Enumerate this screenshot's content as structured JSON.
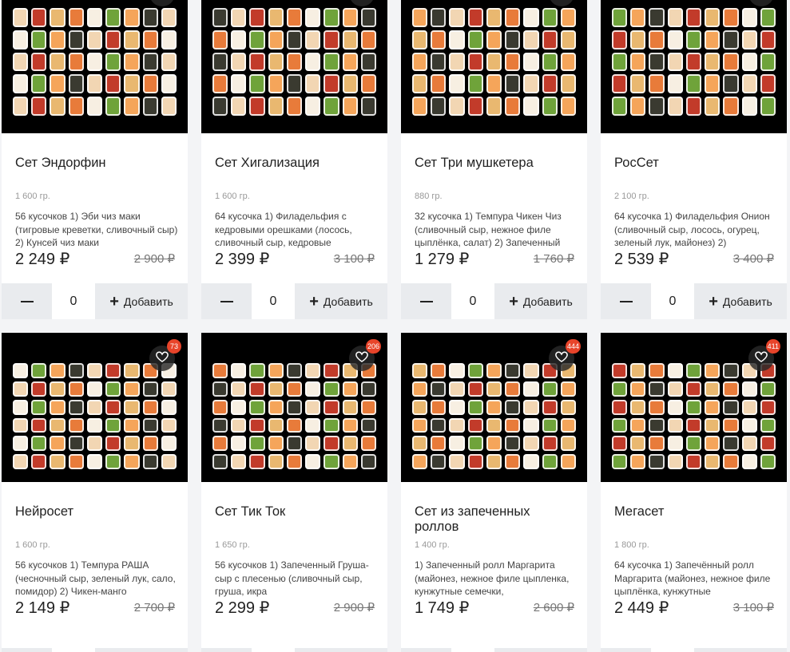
{
  "currency": "₽",
  "products": [
    {
      "title": "Сет Эндорфин",
      "weight": "1 600 гр.",
      "description": "56 кусочков 1) Эби чиз маки (тигровые креветки, сливочный сыр) 2) Кунсей чиз маки",
      "price": "2 249 ₽",
      "old_price": "2 900 ₽",
      "quantity": "0",
      "add_label": "Добавить",
      "badge": ""
    },
    {
      "title": "Сет Хигализация",
      "weight": "1 600 гр.",
      "description": "64 кусочка 1) Филадельфия с кедровыми орешками (лосось, сливочный сыр, кедровые",
      "price": "2 399 ₽",
      "old_price": "3 100 ₽",
      "quantity": "0",
      "add_label": "Добавить",
      "badge": ""
    },
    {
      "title": "Сет Три мушкетера",
      "weight": "880 гр.",
      "description": "32 кусочка 1) Темпура Чикен Чиз (сливочный сыр, нежное филе цыплёнка, салат) 2) Запеченный",
      "price": "1 279 ₽",
      "old_price": "1 760 ₽",
      "quantity": "0",
      "add_label": "Добавить",
      "badge": ""
    },
    {
      "title": "РосСет",
      "weight": "2 100 гр.",
      "description": "64 кусочка 1) Филадельфия Онион (сливочный сыр, лосось, огурец, зеленый лук, майонез) 2)",
      "price": "2 539 ₽",
      "old_price": "3 400 ₽",
      "quantity": "0",
      "add_label": "Добавить",
      "badge": ""
    },
    {
      "title": "Нейросет",
      "weight": "1 600 гр.",
      "description": "56 кусочков 1) Темпура РАША (чесночный сыр, зеленый лук, сало, помидор) 2) Чикен-манго",
      "price": "2 149 ₽",
      "old_price": "2 700 ₽",
      "quantity": "0",
      "add_label": "Добавить",
      "badge": "73"
    },
    {
      "title": "Сет Тик Ток",
      "weight": "1 650 гр.",
      "description": "56 кусочков 1) Запеченный Груша-сыр с плесенью (сливочный сыр, груша, икра",
      "price": "2 299 ₽",
      "old_price": "2 900 ₽",
      "quantity": "0",
      "add_label": "Добавить",
      "badge": "206"
    },
    {
      "title": "Сет из запеченных роллов",
      "weight": "1 400 гр.",
      "description": "1) Запеченный ролл Маргарита (майонез, нежное филе цыпленка, кунжутные семечки,",
      "price": "1 749 ₽",
      "old_price": "2 600 ₽",
      "quantity": "0",
      "add_label": "Добавить",
      "badge": "444"
    },
    {
      "title": "Мегасет",
      "weight": "1 800 гр.",
      "description": "64 кусочка 1) Запечённый ролл Маргарита (майонез, нежное филе цыплёнка, кунжутные",
      "price": "2 449 ₽",
      "old_price": "3 100 ₽",
      "quantity": "0",
      "add_label": "Добавить",
      "badge": "411"
    }
  ],
  "image_palette": [
    "#f2d6b3",
    "#e87b3a",
    "#f5a55a",
    "#c23b2a",
    "#f7efe2",
    "#3a3a30",
    "#e9b870",
    "#6fa33a"
  ]
}
